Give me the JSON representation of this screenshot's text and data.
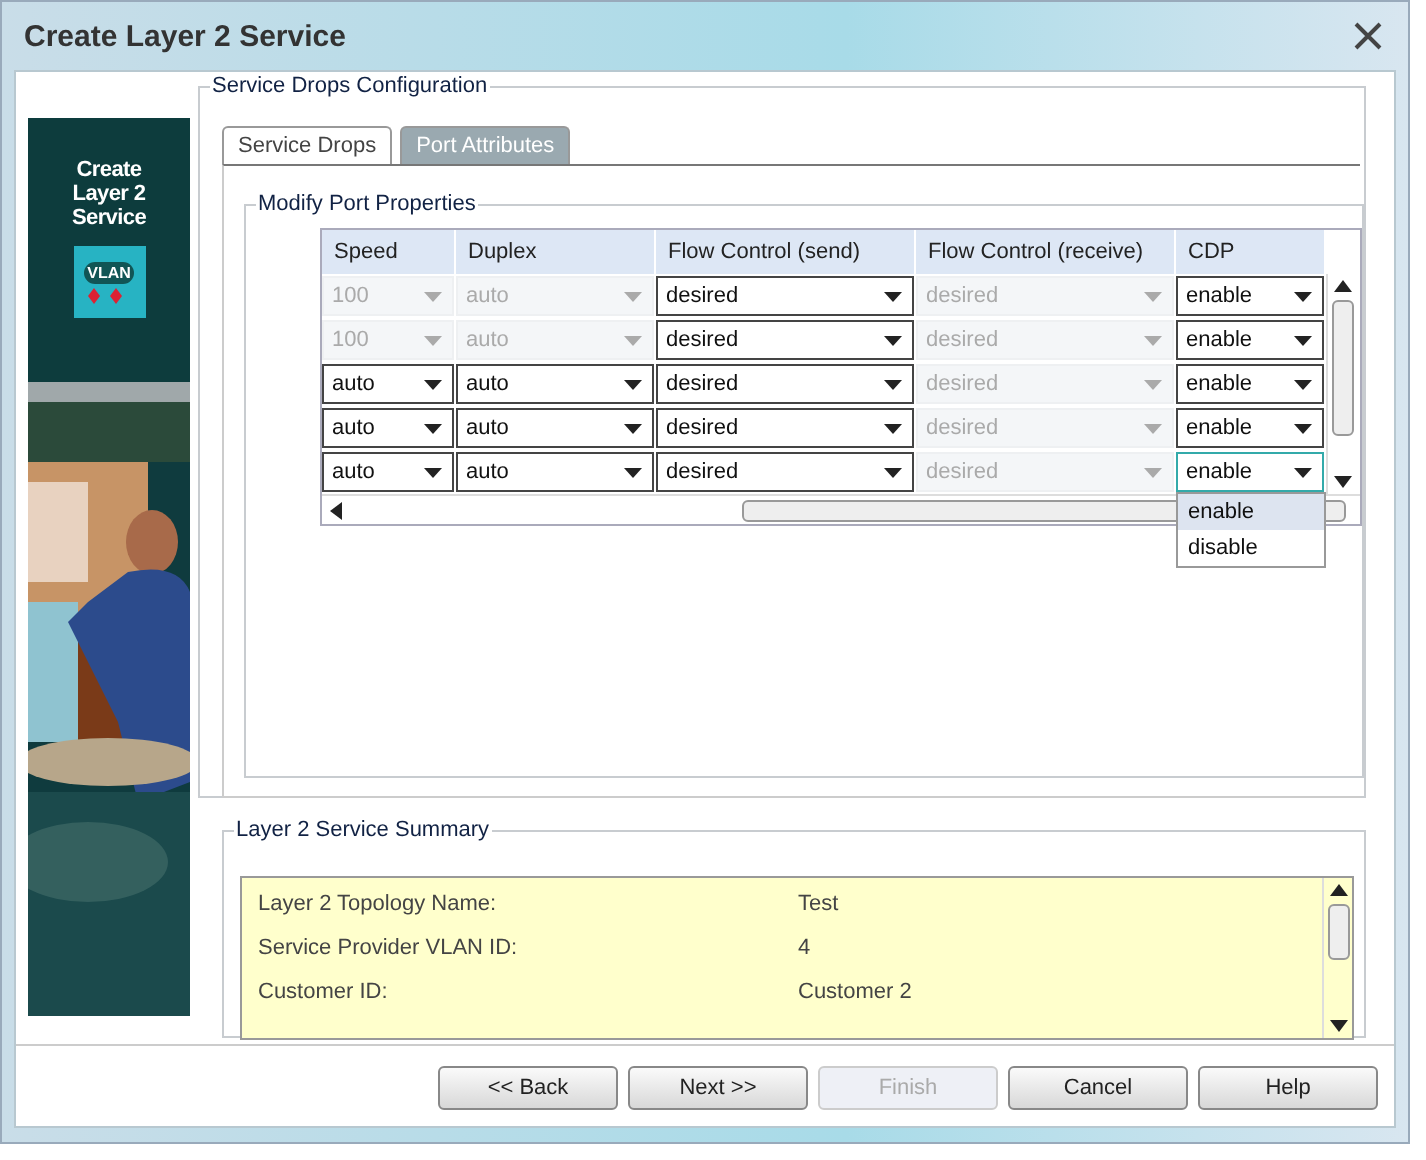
{
  "window": {
    "title": "Create Layer 2 Service"
  },
  "banner": {
    "title": "Create Layer 2 Service",
    "badge": "VLAN",
    "kind": "picture"
  },
  "config": {
    "title": "Service Drops Configuration",
    "tabs": [
      {
        "label": "Service Drops",
        "selected": false
      },
      {
        "label": "Port Attributes",
        "selected": true
      }
    ],
    "group_title": "Modify Port Properties",
    "table": {
      "columns": [
        "Speed",
        "Duplex",
        "Flow Control (send)",
        "Flow Control (receive)",
        "CDP"
      ],
      "rows": [
        {
          "cells": [
            {
              "value": "100",
              "disabled": true
            },
            {
              "value": "auto",
              "disabled": true
            },
            {
              "value": "desired",
              "disabled": false
            },
            {
              "value": "desired",
              "disabled": true
            },
            {
              "value": "enable",
              "disabled": false,
              "open": false
            }
          ]
        },
        {
          "cells": [
            {
              "value": "100",
              "disabled": true
            },
            {
              "value": "auto",
              "disabled": true
            },
            {
              "value": "desired",
              "disabled": false
            },
            {
              "value": "desired",
              "disabled": true
            },
            {
              "value": "enable",
              "disabled": false,
              "open": false
            }
          ]
        },
        {
          "cells": [
            {
              "value": "auto",
              "disabled": false
            },
            {
              "value": "auto",
              "disabled": false
            },
            {
              "value": "desired",
              "disabled": false
            },
            {
              "value": "desired",
              "disabled": true
            },
            {
              "value": "enable",
              "disabled": false,
              "open": false
            }
          ]
        },
        {
          "cells": [
            {
              "value": "auto",
              "disabled": false
            },
            {
              "value": "auto",
              "disabled": false
            },
            {
              "value": "desired",
              "disabled": false
            },
            {
              "value": "desired",
              "disabled": true
            },
            {
              "value": "enable",
              "disabled": false,
              "open": false
            }
          ]
        },
        {
          "cells": [
            {
              "value": "auto",
              "disabled": false
            },
            {
              "value": "auto",
              "disabled": false
            },
            {
              "value": "desired",
              "disabled": false
            },
            {
              "value": "desired",
              "disabled": true
            },
            {
              "value": "enable",
              "disabled": false,
              "open": true
            }
          ]
        }
      ],
      "menu": [
        {
          "label": "enable",
          "selected": true
        },
        {
          "label": "disable",
          "selected": false
        }
      ]
    }
  },
  "summary": {
    "title": "Layer 2 Service Summary",
    "rows": [
      {
        "label": "Layer 2 Topology Name:",
        "value": "Test"
      },
      {
        "label": "Service Provider VLAN ID:",
        "value": "4"
      },
      {
        "label": "Customer ID:",
        "value": "Customer 2"
      }
    ]
  },
  "buttons": [
    {
      "label": "<< Back",
      "disabled": false
    },
    {
      "label": "Next >>",
      "disabled": false
    },
    {
      "label": "Finish",
      "disabled": true
    },
    {
      "label": "Cancel",
      "disabled": false
    },
    {
      "label": "Help",
      "disabled": false
    }
  ]
}
